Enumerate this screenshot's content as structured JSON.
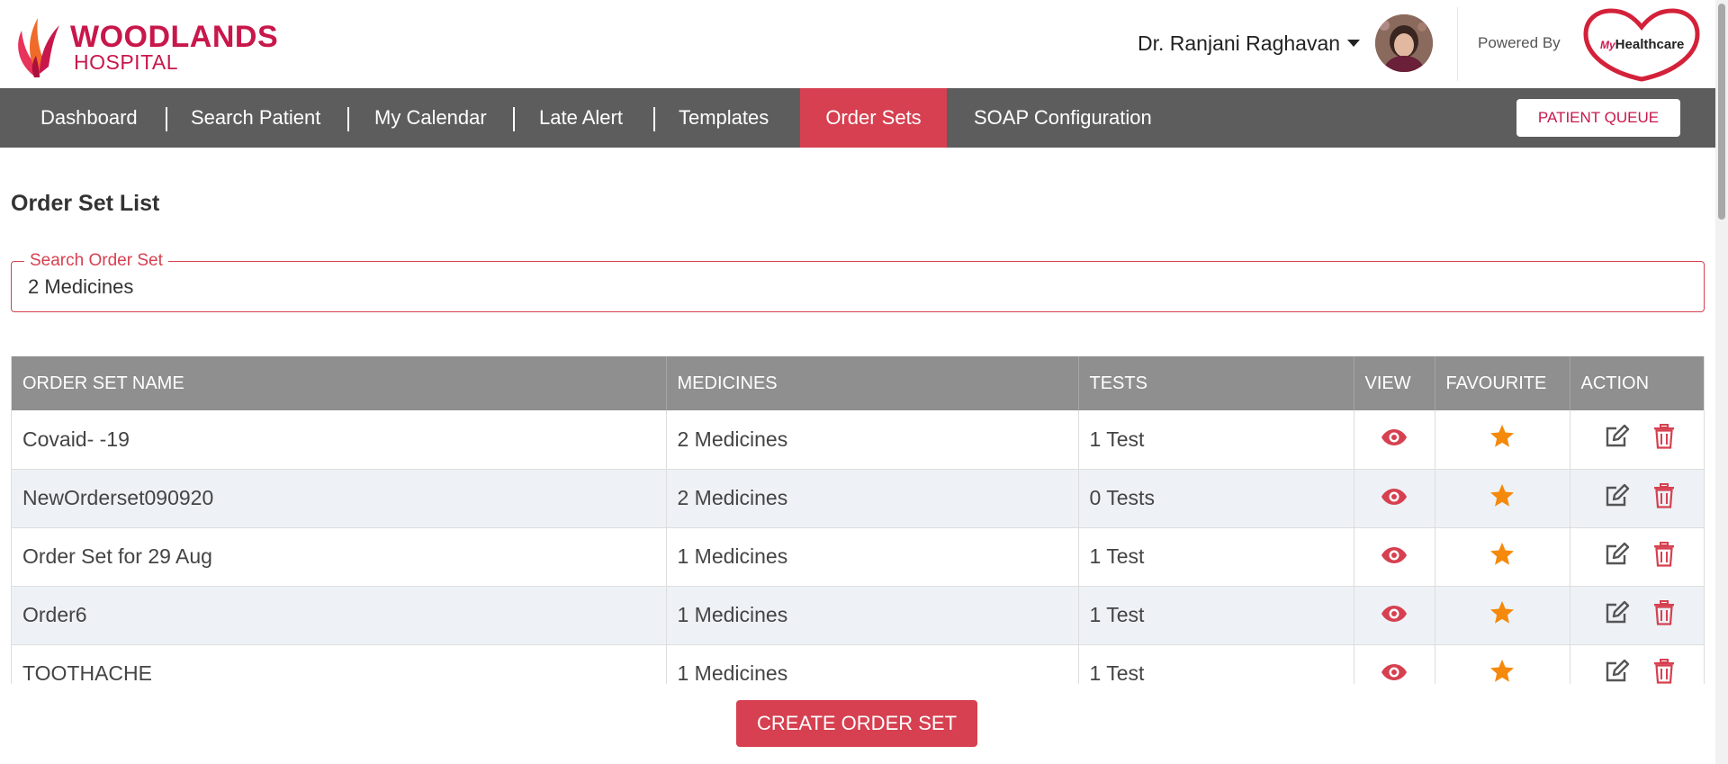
{
  "brand": {
    "line1": "WOODLANDS",
    "line2": "HOSPITAL",
    "primary_color": "#c8174b"
  },
  "user": {
    "name": "Dr. Ranjani Raghavan"
  },
  "powered_by": {
    "label": "Powered By",
    "logo_prefix": "My",
    "logo_text": "Healthcare"
  },
  "nav": {
    "items": [
      {
        "label": "Dashboard"
      },
      {
        "label": "Search Patient"
      },
      {
        "label": "My Calendar"
      },
      {
        "label": "Late Alert"
      },
      {
        "label": "Templates"
      },
      {
        "label": "Order Sets"
      },
      {
        "label": "SOAP Configuration"
      }
    ],
    "active": "Order Sets",
    "queue_button": "PATIENT QUEUE",
    "active_color": "#d64050"
  },
  "page": {
    "title": "Order Set List"
  },
  "search": {
    "label": "Search Order Set",
    "value": "2 Medicines"
  },
  "table": {
    "headers": [
      "ORDER SET NAME",
      "MEDICINES",
      "TESTS",
      "VIEW",
      "FAVOURITE",
      "ACTION"
    ],
    "rows": [
      {
        "name": "Covaid- -19",
        "medicines": "2 Medicines",
        "tests": "1 Test"
      },
      {
        "name": "NewOrderset090920",
        "medicines": "2 Medicines",
        "tests": "0 Tests"
      },
      {
        "name": "Order Set for 29 Aug",
        "medicines": "1 Medicines",
        "tests": "1 Test"
      },
      {
        "name": "Order6",
        "medicines": "1 Medicines",
        "tests": "1 Test"
      },
      {
        "name": "TOOTHACHE",
        "medicines": "1 Medicines",
        "tests": "1 Test"
      }
    ],
    "icons": {
      "view": "eye-icon",
      "favourite": "star-icon",
      "edit": "edit-icon",
      "delete": "trash-icon"
    },
    "favourite_color": "#f5890b"
  },
  "create_button": "CREATE ORDER SET"
}
